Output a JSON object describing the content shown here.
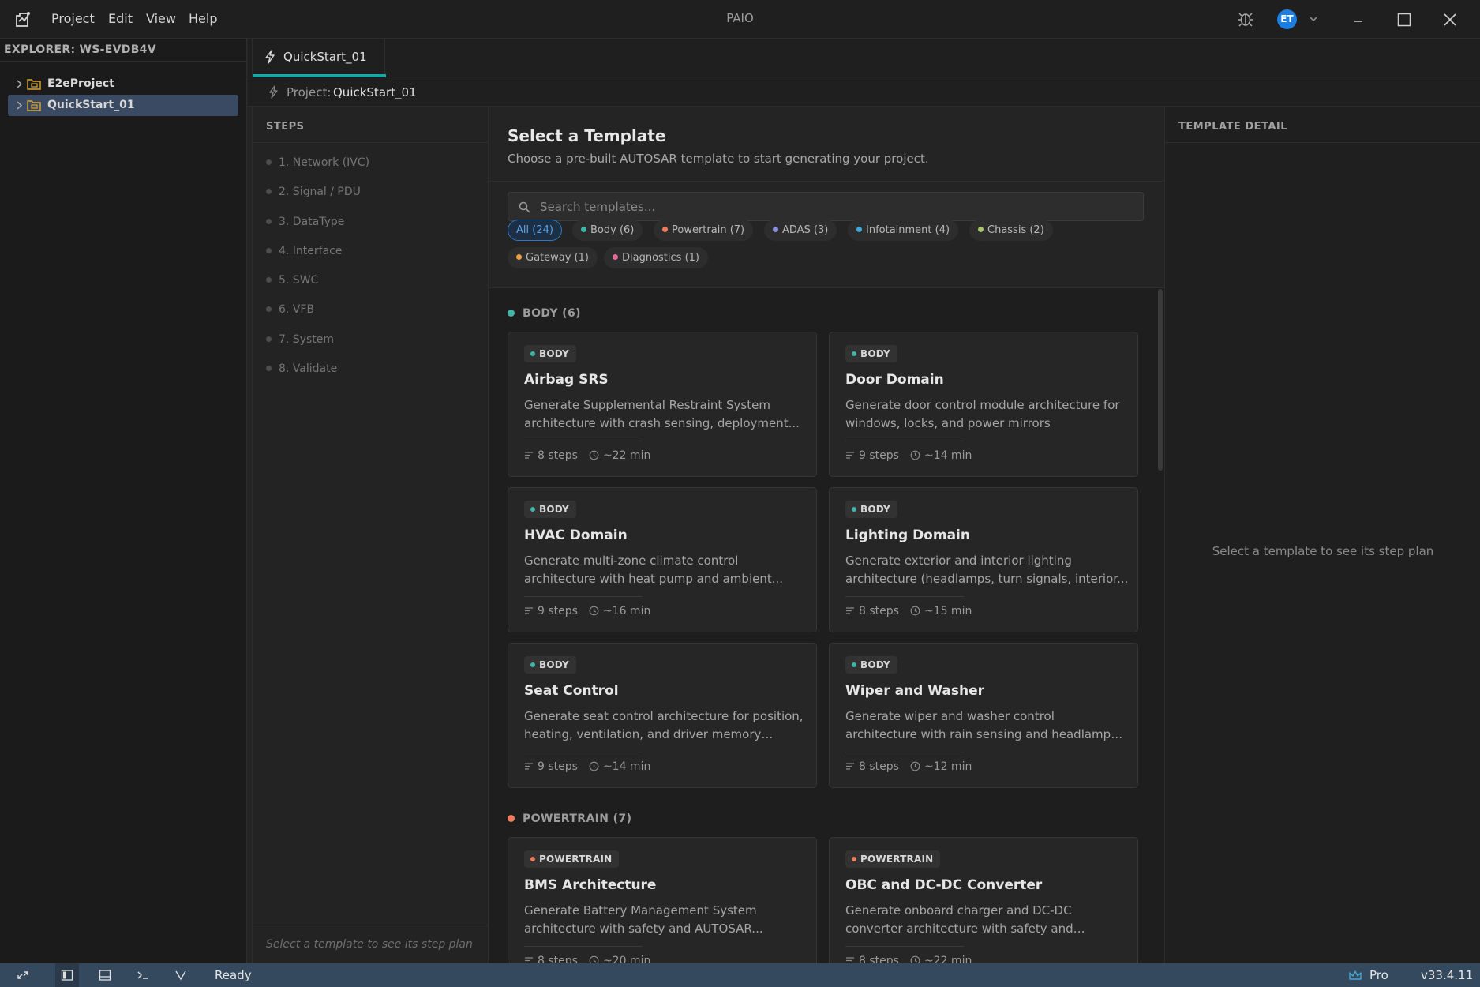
{
  "app": {
    "title": "PAIO",
    "menu": [
      "Project",
      "Edit",
      "View",
      "Help"
    ],
    "user_initials": "ET",
    "accent": "#1aa6a6"
  },
  "explorer": {
    "title": "EXPLORER: WS-EVDB4V",
    "items": [
      {
        "label": "E2eProject",
        "selected": false
      },
      {
        "label": "QuickStart_01",
        "selected": true
      }
    ]
  },
  "editor": {
    "tab_label": "QuickStart_01",
    "breadcrumb_prefix": "Project:",
    "breadcrumb_name": "QuickStart_01"
  },
  "steps": {
    "title": "STEPS",
    "items": [
      "1. Network (IVC)",
      "2. Signal / PDU",
      "3. DataType",
      "4. Interface",
      "5. SWC",
      "6. VFB",
      "7. System",
      "8. Validate"
    ],
    "footer": "Select a template to see its step plan"
  },
  "selector": {
    "title": "Select a Template",
    "subtitle": "Choose a pre-built AUTOSAR template to start generating your project.",
    "search_placeholder": "Search templates...",
    "chips": [
      {
        "label": "All (24)",
        "color": "",
        "active": true
      },
      {
        "label": "Body (6)",
        "color": "#3fb6a8",
        "active": false
      },
      {
        "label": "Powertrain (7)",
        "color": "#ee7b5c",
        "active": false
      },
      {
        "label": "ADAS (3)",
        "color": "#8b8fe0",
        "active": false
      },
      {
        "label": "Infotainment (4)",
        "color": "#3fa8d8",
        "active": false
      },
      {
        "label": "Chassis (2)",
        "color": "#a8c46a",
        "active": false
      },
      {
        "label": "Gateway (1)",
        "color": "#f0a040",
        "active": false
      },
      {
        "label": "Diagnostics (1)",
        "color": "#e86a9a",
        "active": false
      }
    ],
    "sections": [
      {
        "heading": "BODY (6)",
        "color": "#3fb6a8",
        "cards": [
          {
            "badge": "BODY",
            "title": "Airbag SRS",
            "desc": "Generate Supplemental Restraint System architecture with crash sensing, deployment...",
            "steps": "8 steps",
            "time": "~22 min"
          },
          {
            "badge": "BODY",
            "title": "Door Domain",
            "desc": "Generate door control module architecture for windows, locks, and power mirrors",
            "steps": "9 steps",
            "time": "~14 min"
          },
          {
            "badge": "BODY",
            "title": "HVAC Domain",
            "desc": "Generate multi-zone climate control architecture with heat pump and ambient...",
            "steps": "9 steps",
            "time": "~16 min"
          },
          {
            "badge": "BODY",
            "title": "Lighting Domain",
            "desc": "Generate exterior and interior lighting architecture (headlamps, turn signals, interior...",
            "steps": "8 steps",
            "time": "~15 min"
          },
          {
            "badge": "BODY",
            "title": "Seat Control",
            "desc": "Generate seat control architecture for position, heating, ventilation, and driver memory profiles",
            "steps": "9 steps",
            "time": "~14 min"
          },
          {
            "badge": "BODY",
            "title": "Wiper and Washer",
            "desc": "Generate wiper and washer control architecture with rain sensing and headlamp cleaning",
            "steps": "8 steps",
            "time": "~12 min"
          }
        ]
      },
      {
        "heading": "POWERTRAIN (7)",
        "color": "#ee7b5c",
        "cards": [
          {
            "badge": "POWERTRAIN",
            "title": "BMS Architecture",
            "desc": "Generate Battery Management System architecture with safety and AUTOSAR...",
            "steps": "8 steps",
            "time": "~20 min"
          },
          {
            "badge": "POWERTRAIN",
            "title": "OBC and DC-DC Converter",
            "desc": "Generate onboard charger and DC-DC converter architecture with safety and AUTOSAR...",
            "steps": "8 steps",
            "time": "~22 min"
          }
        ]
      }
    ]
  },
  "detail": {
    "title": "TEMPLATE DETAIL",
    "empty": "Select a template to see its step plan"
  },
  "status": {
    "text": "Ready",
    "plan": "Pro",
    "version": "v33.4.11",
    "bar_color": "#34495e"
  }
}
